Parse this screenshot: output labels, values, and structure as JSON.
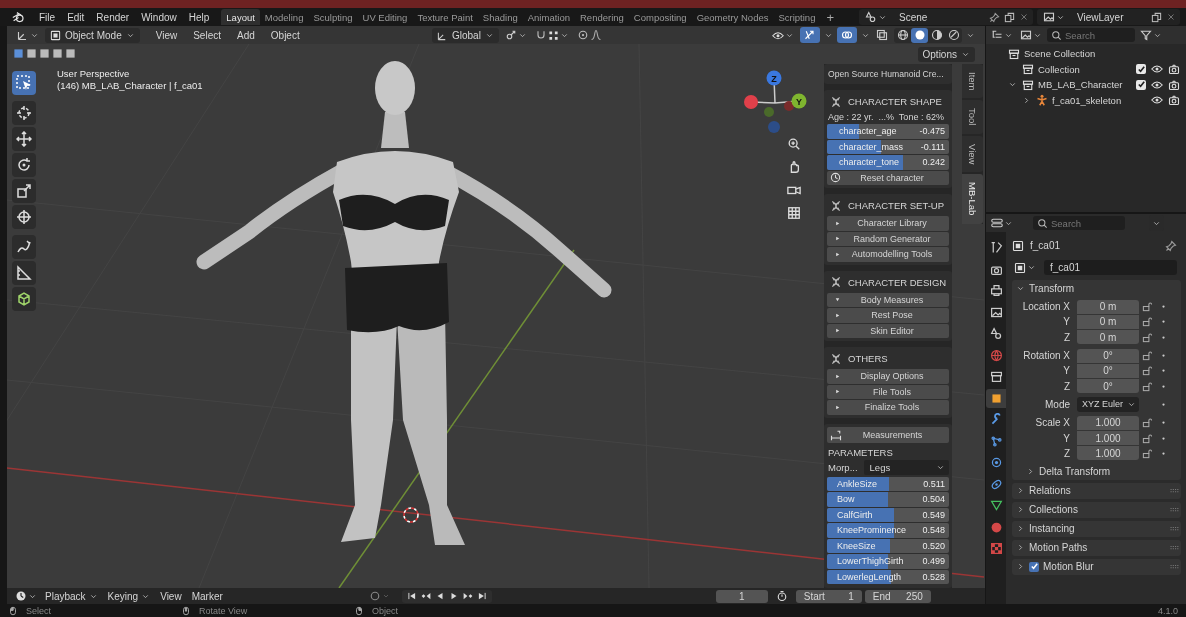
{
  "top_bar": {
    "menus": [
      "File",
      "Edit",
      "Render",
      "Window",
      "Help"
    ],
    "workspaces": [
      {
        "label": "Layout",
        "selected": true
      },
      {
        "label": "Modeling",
        "selected": false
      },
      {
        "label": "Sculpting",
        "selected": false
      },
      {
        "label": "UV Editing",
        "selected": false
      },
      {
        "label": "Texture Paint",
        "selected": false
      },
      {
        "label": "Shading",
        "selected": false
      },
      {
        "label": "Animation",
        "selected": false
      },
      {
        "label": "Rendering",
        "selected": false
      },
      {
        "label": "Compositing",
        "selected": false
      },
      {
        "label": "Geometry Nodes",
        "selected": false
      },
      {
        "label": "Scripting",
        "selected": false
      }
    ],
    "add_workspace": "+",
    "scene": "Scene",
    "view_layer": "ViewLayer"
  },
  "viewport_header": {
    "mode": "Object Mode",
    "menus": [
      "View",
      "Select",
      "Add",
      "Object"
    ],
    "orientation": "Global",
    "shading": [
      {
        "kind": "wireframe",
        "selected": false
      },
      {
        "kind": "solid",
        "selected": true
      },
      {
        "kind": "material",
        "selected": false
      },
      {
        "kind": "rendered",
        "selected": false
      }
    ],
    "options": "Options"
  },
  "viewport": {
    "perspective": "User Perspective",
    "object_info": "(146) MB_LAB_Character | f_ca01",
    "axis_labels": [
      "Z",
      "Y"
    ],
    "tools": [
      {
        "kind": "select",
        "selected": true
      },
      {
        "kind": "cursor",
        "selected": false
      },
      {
        "kind": "move",
        "selected": false
      },
      {
        "kind": "rotate",
        "selected": false
      },
      {
        "kind": "scale",
        "selected": false
      },
      {
        "kind": "transform",
        "selected": false
      },
      {
        "kind": "annotate",
        "selected": false
      },
      {
        "kind": "measure",
        "selected": false
      },
      {
        "kind": "add_cube",
        "selected": false
      }
    ]
  },
  "sidebar_tabs": [
    {
      "label": "Item",
      "selected": false
    },
    {
      "label": "Tool",
      "selected": false
    },
    {
      "label": "View",
      "selected": false
    },
    {
      "label": "MB-Lab",
      "selected": true
    }
  ],
  "mb_lab": {
    "title": "Open Source Humanoid Cre...",
    "shape": {
      "header": "CHARACTER SHAPE",
      "summary": "Age : 22 yr.  ...%  Tone : 62%",
      "sliders": [
        {
          "name": "character_age",
          "reading": "-0.475",
          "level": 0.26
        },
        {
          "name": "character_mass",
          "reading": "-0.111",
          "level": 0.44
        },
        {
          "name": "character_tone",
          "reading": "0.242",
          "level": 0.62
        }
      ],
      "reset": "Reset character"
    },
    "sections": [
      {
        "header": "CHARACTER SET-UP",
        "buttons": [
          {
            "label": "Character Library",
            "expanded": false
          },
          {
            "label": "Random Generator",
            "expanded": false
          },
          {
            "label": "Automodelling Tools",
            "expanded": false
          }
        ]
      },
      {
        "header": "CHARACTER DESIGN",
        "buttons": [
          {
            "label": "Body Measures",
            "expanded": true
          },
          {
            "label": "Rest Pose",
            "expanded": false
          },
          {
            "label": "Skin Editor",
            "expanded": false
          }
        ]
      },
      {
        "header": "OTHERS",
        "buttons": [
          {
            "label": "Display Options",
            "expanded": false
          },
          {
            "label": "File Tools",
            "expanded": false
          },
          {
            "label": "Finalize Tools",
            "expanded": false
          }
        ]
      }
    ],
    "measurements": "Measurements",
    "parameters_label": "PARAMETERS",
    "morph_label": "Morp...",
    "morph_value": "Legs",
    "parameters": [
      {
        "name": "AnkleSize",
        "reading": "0.511",
        "level": 0.511
      },
      {
        "name": "Bow",
        "reading": "0.504",
        "level": 0.504
      },
      {
        "name": "CalfGirth",
        "reading": "0.549",
        "level": 0.549
      },
      {
        "name": "KneeProminence",
        "reading": "0.548",
        "level": 0.548
      },
      {
        "name": "KneeSize",
        "reading": "0.520",
        "level": 0.52
      },
      {
        "name": "LowerThighGirth",
        "reading": "0.499",
        "level": 0.499
      },
      {
        "name": "LowerlegLength",
        "reading": "0.528",
        "level": 0.528
      }
    ]
  },
  "outliner": {
    "search": {
      "placeholder": "Search"
    },
    "tree": [
      {
        "label": "Scene Collection",
        "kind": "scene_collection",
        "children": [
          {
            "label": "Collection",
            "kind": "collection",
            "checked": true
          },
          {
            "label": "MB_LAB_Character",
            "kind": "collection",
            "checked": true,
            "expanded": true,
            "children": [
              {
                "label": "f_ca01_skeleton",
                "kind": "armature",
                "expanded": false
              }
            ]
          }
        ]
      }
    ]
  },
  "properties": {
    "search": {
      "placeholder": "Search"
    },
    "tabs": [
      {
        "kind": "tool",
        "selected": false
      },
      {
        "kind": "render",
        "selected": false
      },
      {
        "kind": "output",
        "selected": false
      },
      {
        "kind": "view_layer",
        "selected": false
      },
      {
        "kind": "scene",
        "selected": false
      },
      {
        "kind": "world",
        "selected": false
      },
      {
        "kind": "collection",
        "selected": false
      },
      {
        "kind": "object",
        "selected": true
      },
      {
        "kind": "modifiers",
        "selected": false
      },
      {
        "kind": "particles",
        "selected": false
      },
      {
        "kind": "physics",
        "selected": false
      },
      {
        "kind": "constraints",
        "selected": false
      },
      {
        "kind": "data",
        "selected": false
      },
      {
        "kind": "material",
        "selected": false
      },
      {
        "kind": "texture",
        "selected": false
      }
    ],
    "object_name": "f_ca01",
    "data_name": "f_ca01",
    "transform": {
      "header": "Transform",
      "expanded": true,
      "groups": [
        [
          {
            "label": "Location X",
            "value": "0 m",
            "kind": "number"
          },
          {
            "label": "Y",
            "value": "0 m",
            "kind": "number"
          },
          {
            "label": "Z",
            "value": "0 m",
            "kind": "number"
          }
        ],
        [
          {
            "label": "Rotation X",
            "value": "0°",
            "kind": "number"
          },
          {
            "label": "Y",
            "value": "0°",
            "kind": "number"
          },
          {
            "label": "Z",
            "value": "0°",
            "kind": "number"
          }
        ],
        [
          {
            "label": "Mode",
            "value": "XYZ Euler",
            "kind": "dropdown"
          }
        ],
        [
          {
            "label": "Scale X",
            "value": "1.000",
            "kind": "number"
          },
          {
            "label": "Y",
            "value": "1.000",
            "kind": "number"
          },
          {
            "label": "Z",
            "value": "1.000",
            "kind": "number"
          }
        ]
      ],
      "sub_panel": {
        "label": "Delta Transform",
        "expanded": false
      }
    },
    "panels": [
      {
        "label": "Relations",
        "expanded": false
      },
      {
        "label": "Collections",
        "expanded": false
      },
      {
        "label": "Instancing",
        "expanded": false
      },
      {
        "label": "Motion Paths",
        "expanded": false
      },
      {
        "label": "Motion Blur",
        "expanded": false,
        "checked": true
      }
    ]
  },
  "timeline": {
    "menus": [
      {
        "label": "Playback",
        "kind": "dropdown"
      },
      {
        "label": "Keying",
        "kind": "dropdown"
      },
      {
        "label": "View",
        "kind": "plain"
      },
      {
        "label": "Marker",
        "kind": "plain"
      }
    ],
    "current_frame": "1",
    "start_label": "Start",
    "start": "1",
    "end_label": "End",
    "end": "250"
  },
  "status_bar": {
    "items": [
      {
        "kind": "left_click",
        "label": "Select"
      },
      {
        "kind": "middle_click",
        "label": "Rotate View"
      },
      {
        "kind": "right_click",
        "label": "Object"
      }
    ],
    "version": "4.1.0"
  }
}
